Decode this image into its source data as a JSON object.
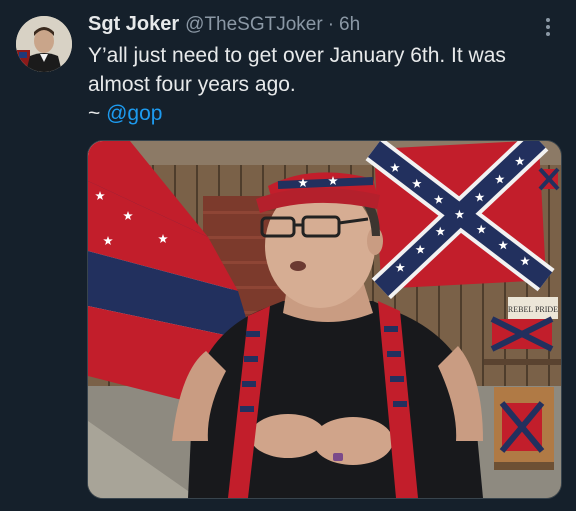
{
  "tweet": {
    "display_name": "Sgt Joker",
    "handle": "@TheSGTJoker",
    "separator": "·",
    "time": "6h",
    "text_line1": "Y’all just need to get over January 6th. It was",
    "text_line2": "almost four years ago.",
    "sig_prefix": "~ ",
    "mention": "@gop",
    "media_sign": "REBEL PRIDE"
  },
  "icons": {
    "more": "more-horizontal-icon"
  },
  "colors": {
    "background": "#15202b",
    "text": "#e7e9ea",
    "secondary": "#8b98a5",
    "link": "#1d9bf0"
  }
}
